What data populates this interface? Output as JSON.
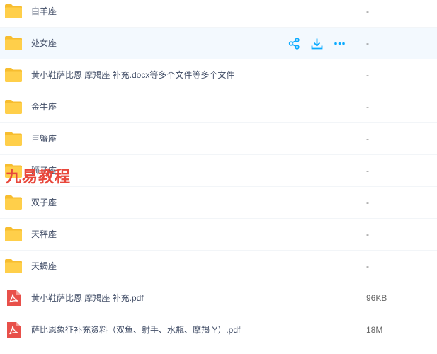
{
  "files": [
    {
      "name": "白羊座",
      "type": "folder",
      "size": "-"
    },
    {
      "name": "处女座",
      "type": "folder",
      "size": "-",
      "hover": true
    },
    {
      "name": "黄小鞋萨比恩 摩羯座 补充.docx等多个文件等多个文件",
      "type": "folder",
      "size": "-"
    },
    {
      "name": "金牛座",
      "type": "folder",
      "size": "-"
    },
    {
      "name": "巨蟹座",
      "type": "folder",
      "size": "-"
    },
    {
      "name": "狮子座",
      "type": "folder",
      "size": "-"
    },
    {
      "name": "双子座",
      "type": "folder",
      "size": "-"
    },
    {
      "name": "天秤座",
      "type": "folder",
      "size": "-"
    },
    {
      "name": "天蝎座",
      "type": "folder",
      "size": "-"
    },
    {
      "name": "黄小鞋萨比恩 摩羯座 补充.pdf",
      "type": "pdf",
      "size": "96KB"
    },
    {
      "name": "萨比恩象征补充资料（双鱼、射手、水瓶、摩羯 Y）.pdf",
      "type": "pdf",
      "size": "18M"
    }
  ],
  "hover_actions": [
    {
      "icon": "share-icon"
    },
    {
      "icon": "download-icon"
    },
    {
      "icon": "more-icon"
    }
  ],
  "watermark": "九易教程",
  "colors": {
    "folder": "#ffcf4a",
    "folder_tab": "#f7bd2f",
    "pdf": "#e8504a",
    "accent": "#09aaff",
    "hover_row": "#f3f9fe"
  }
}
